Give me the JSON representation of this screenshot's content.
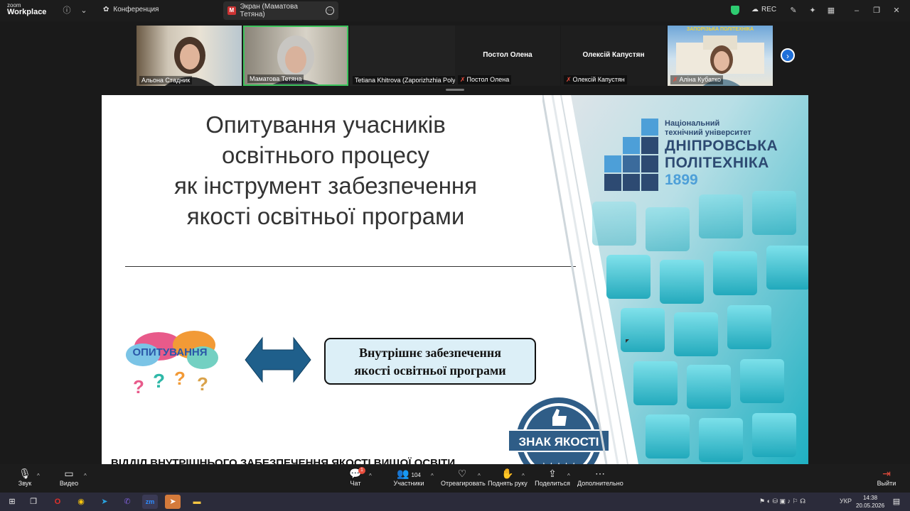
{
  "topbar": {
    "brand_small": "zoom",
    "brand_big": "Workplace",
    "conference_label": "Конференция",
    "share_tab_label": "Экран (Маматова Тетяна)",
    "rec_label": "REC"
  },
  "participants": [
    {
      "name": "Альона Стадник",
      "video": true
    },
    {
      "name": "Маматова Тетяна",
      "video": true,
      "active": true
    },
    {
      "name": "Tetiana Khitrova (Zaporizhzhia Polyt...",
      "video": false
    },
    {
      "name": "Постол Олена",
      "display": "Постол Олена",
      "muted": true
    },
    {
      "name": "Олексій Капустян",
      "display": "Олексій Капустян",
      "muted": true
    },
    {
      "name": "Аліна Кубатко",
      "video": true,
      "muted": true,
      "banner": "ЗАПОРІЗЬКА ПОЛІТЕХНІКА"
    }
  ],
  "slide": {
    "title_lines": [
      "Опитування учасників",
      "освітнього процесу",
      "як інструмент забезпечення",
      "якості освітньої програми"
    ],
    "bubble_word": "ОПИТУВАННЯ",
    "box_lines": [
      "Внутрішнє забезпечення",
      "якості освітньої програми"
    ],
    "seal_text": "ЗНАК ЯКОСТІ",
    "bottom_text": "ВІДДІЛ ВНУТРІШНЬОГО ЗАБЕЗПЕЧЕННЯ ЯКОСТІ ВИЩОЇ ОСВІТИ",
    "logo_line1": "Національний",
    "logo_line2": "технічний університет",
    "logo_line3": "ДНІПРОВСЬКА",
    "logo_line4": "ПОЛІТЕХНІКА",
    "logo_year": "1899"
  },
  "toolbar": {
    "audio": "Звук",
    "video": "Видео",
    "chat": "Чат",
    "chat_badge": "1",
    "participants": "Участники",
    "participants_count": "104",
    "react": "Отреагировать",
    "raise_hand": "Поднять руку",
    "share": "Поделиться",
    "more": "Дополнительно",
    "leave": "Выйти"
  },
  "taskbar": {
    "lang": "УКР",
    "time": "14:38",
    "date": "20.05.2026"
  },
  "colors": {
    "slide_teal": "#2bbdc8",
    "logo_blue": "#2d4a72",
    "box_fill": "#dceff7",
    "arrow": "#1f5f8b"
  }
}
